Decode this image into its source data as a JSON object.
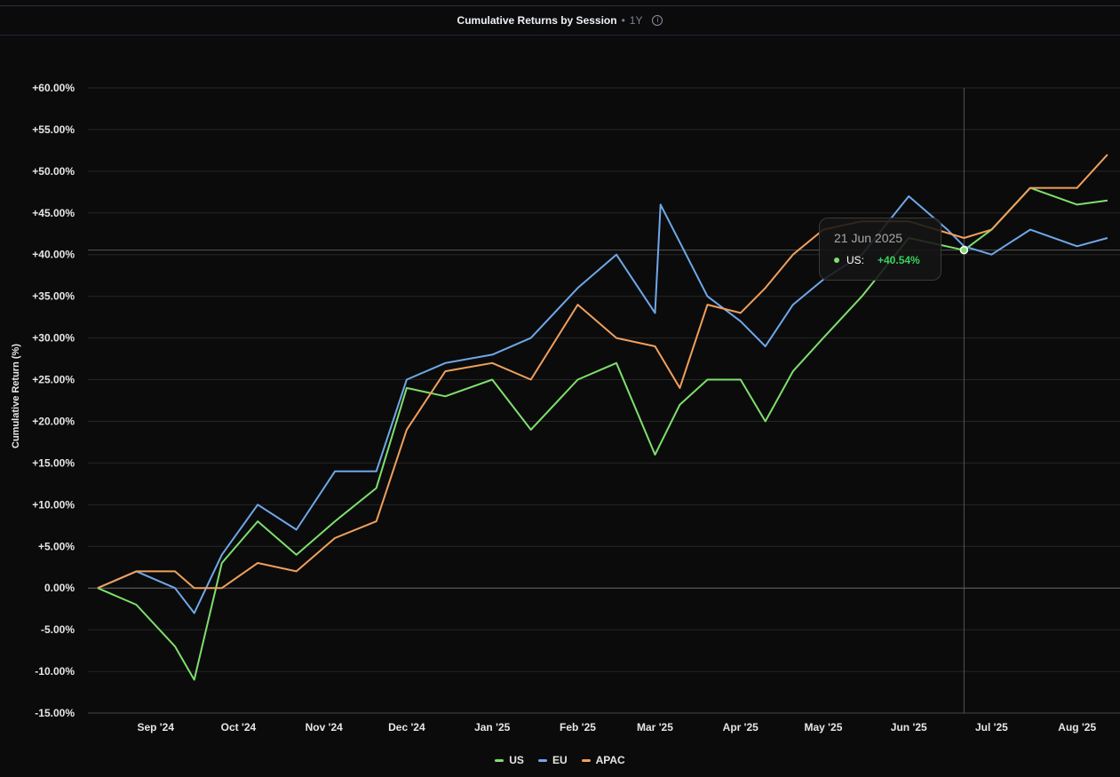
{
  "header": {
    "title": "Cumulative Returns by Session",
    "separator": "•",
    "period": "1Y",
    "info_icon": "info-icon"
  },
  "tooltip": {
    "date": "21 Jun 2025",
    "series": "US:",
    "value": "+40.54%"
  },
  "chart_data": {
    "type": "line",
    "title": "Cumulative Returns by Session",
    "xlabel": "",
    "ylabel": "Cumulative Return (%)",
    "ylim": [
      -15,
      60
    ],
    "ytick_values": [
      -15,
      -10,
      -5,
      0,
      5,
      10,
      15,
      20,
      25,
      30,
      35,
      40,
      45,
      50,
      55,
      60
    ],
    "ytick_labels": [
      "-15.00%",
      "-10.00%",
      "-5.00%",
      "0.00%",
      "+5.00%",
      "+10.00%",
      "+15.00%",
      "+20.00%",
      "+25.00%",
      "+30.00%",
      "+35.00%",
      "+40.00%",
      "+45.00%",
      "+50.00%",
      "+55.00%",
      "+60.00%"
    ],
    "xtick_dates": [
      "2024-09-01",
      "2024-10-01",
      "2024-11-01",
      "2024-12-01",
      "2025-01-01",
      "2025-02-01",
      "2025-03-01",
      "2025-04-01",
      "2025-05-01",
      "2025-06-01",
      "2025-07-01",
      "2025-08-01"
    ],
    "xtick_labels": [
      "Sep '24",
      "Oct '24",
      "Nov '24",
      "Dec '24",
      "Jan '25",
      "Feb '25",
      "Mar '25",
      "Apr '25",
      "May '25",
      "Jun '25",
      "Jul '25",
      "Aug '25"
    ],
    "xlim": [
      "2024-08-11",
      "2025-08-13"
    ],
    "grid": true,
    "legend_position": "bottom-center",
    "crosshair": {
      "date": "2025-06-21",
      "value": 40.54
    },
    "series": [
      {
        "name": "US",
        "color": "#7ee06b",
        "points": [
          [
            "2024-08-11",
            0
          ],
          [
            "2024-08-25",
            -2
          ],
          [
            "2024-09-08",
            -7
          ],
          [
            "2024-09-15",
            -11
          ],
          [
            "2024-09-25",
            3
          ],
          [
            "2024-10-08",
            8
          ],
          [
            "2024-10-22",
            4
          ],
          [
            "2024-11-05",
            8
          ],
          [
            "2024-11-20",
            12
          ],
          [
            "2024-12-01",
            24
          ],
          [
            "2024-12-15",
            23
          ],
          [
            "2025-01-01",
            25
          ],
          [
            "2025-01-15",
            19
          ],
          [
            "2025-02-01",
            25
          ],
          [
            "2025-02-15",
            27
          ],
          [
            "2025-03-01",
            16
          ],
          [
            "2025-03-10",
            22
          ],
          [
            "2025-03-20",
            25
          ],
          [
            "2025-04-01",
            25
          ],
          [
            "2025-04-10",
            20
          ],
          [
            "2025-04-20",
            26
          ],
          [
            "2025-05-01",
            30
          ],
          [
            "2025-05-15",
            35
          ],
          [
            "2025-06-01",
            42
          ],
          [
            "2025-06-21",
            40.54
          ],
          [
            "2025-07-01",
            43
          ],
          [
            "2025-07-15",
            48
          ],
          [
            "2025-08-01",
            46
          ],
          [
            "2025-08-12",
            46.5
          ]
        ]
      },
      {
        "name": "EU",
        "color": "#6fa8e8",
        "points": [
          [
            "2024-08-11",
            0
          ],
          [
            "2024-08-25",
            2
          ],
          [
            "2024-09-08",
            0
          ],
          [
            "2024-09-15",
            -3
          ],
          [
            "2024-09-25",
            4
          ],
          [
            "2024-10-08",
            10
          ],
          [
            "2024-10-22",
            7
          ],
          [
            "2024-11-05",
            14
          ],
          [
            "2024-11-20",
            14
          ],
          [
            "2024-12-01",
            25
          ],
          [
            "2024-12-15",
            27
          ],
          [
            "2025-01-01",
            28
          ],
          [
            "2025-01-15",
            30
          ],
          [
            "2025-02-01",
            36
          ],
          [
            "2025-02-15",
            40
          ],
          [
            "2025-03-01",
            33
          ],
          [
            "2025-03-03",
            46
          ],
          [
            "2025-03-20",
            35
          ],
          [
            "2025-04-01",
            32
          ],
          [
            "2025-04-10",
            29
          ],
          [
            "2025-04-20",
            34
          ],
          [
            "2025-05-01",
            37
          ],
          [
            "2025-05-15",
            40
          ],
          [
            "2025-06-01",
            47
          ],
          [
            "2025-06-15",
            43
          ],
          [
            "2025-06-21",
            41
          ],
          [
            "2025-07-01",
            40
          ],
          [
            "2025-07-15",
            43
          ],
          [
            "2025-08-01",
            41
          ],
          [
            "2025-08-12",
            42
          ]
        ]
      },
      {
        "name": "APAC",
        "color": "#f0a05a",
        "points": [
          [
            "2024-08-11",
            0
          ],
          [
            "2024-08-25",
            2
          ],
          [
            "2024-09-08",
            2
          ],
          [
            "2024-09-15",
            0
          ],
          [
            "2024-09-25",
            0
          ],
          [
            "2024-10-08",
            3
          ],
          [
            "2024-10-22",
            2
          ],
          [
            "2024-11-05",
            6
          ],
          [
            "2024-11-20",
            8
          ],
          [
            "2024-12-01",
            19
          ],
          [
            "2024-12-15",
            26
          ],
          [
            "2025-01-01",
            27
          ],
          [
            "2025-01-15",
            25
          ],
          [
            "2025-02-01",
            34
          ],
          [
            "2025-02-15",
            30
          ],
          [
            "2025-03-01",
            29
          ],
          [
            "2025-03-10",
            24
          ],
          [
            "2025-03-20",
            34
          ],
          [
            "2025-04-01",
            33
          ],
          [
            "2025-04-10",
            36
          ],
          [
            "2025-04-20",
            40
          ],
          [
            "2025-05-01",
            43
          ],
          [
            "2025-05-15",
            44
          ],
          [
            "2025-06-01",
            44
          ],
          [
            "2025-06-21",
            42
          ],
          [
            "2025-07-01",
            43
          ],
          [
            "2025-07-15",
            48
          ],
          [
            "2025-08-01",
            48
          ],
          [
            "2025-08-12",
            52
          ]
        ]
      }
    ]
  }
}
